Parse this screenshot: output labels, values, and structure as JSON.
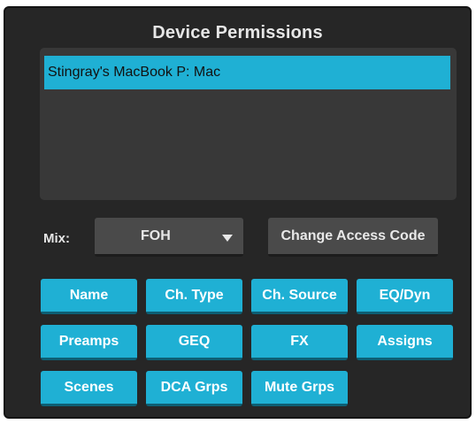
{
  "panel": {
    "title": "Device Permissions"
  },
  "devices": [
    {
      "label": "Stingray's MacBook P: Mac",
      "selected": true
    }
  ],
  "mix": {
    "label": "Mix:",
    "value": "FOH"
  },
  "access": {
    "label": "Change Access Code"
  },
  "permissions": [
    {
      "label": "Name"
    },
    {
      "label": "Ch. Type"
    },
    {
      "label": "Ch. Source"
    },
    {
      "label": "EQ/Dyn"
    },
    {
      "label": "Preamps"
    },
    {
      "label": "GEQ"
    },
    {
      "label": "FX"
    },
    {
      "label": "Assigns"
    },
    {
      "label": "Scenes"
    },
    {
      "label": "DCA Grps"
    },
    {
      "label": "Mute Grps"
    }
  ],
  "colors": {
    "accent": "#1fb0d4",
    "panel_bg": "#262626",
    "list_bg": "#383838",
    "control_bg": "#4a4a4a"
  }
}
